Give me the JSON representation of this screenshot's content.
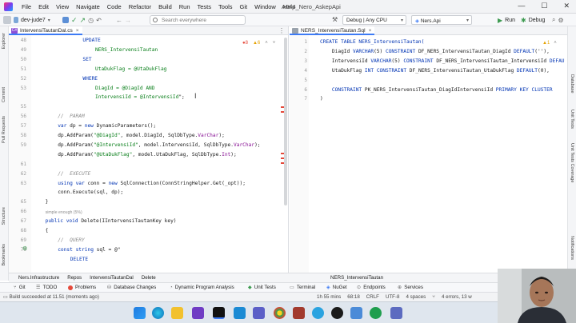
{
  "window": {
    "menu": [
      "File",
      "Edit",
      "View",
      "Navigate",
      "Code",
      "Refactor",
      "Build",
      "Run",
      "Tests",
      "Tools",
      "Git",
      "Window",
      "Help"
    ],
    "app_name": "A044_Nero_AskepApi",
    "minimize_glyph": "—",
    "maximize_glyph": "☐",
    "close_glyph": "✕"
  },
  "toolbar": {
    "branch": "dev-jude7",
    "search_placeholder": "Search everywhere",
    "config": "Debug | Any CPU",
    "project": "Ners.Api",
    "run_label": "Run",
    "debug_label": "Debug"
  },
  "left_strip": [
    "Explorer",
    "Commit",
    "Pull Requests",
    "Structure",
    "Bookmarks"
  ],
  "right_strip": [
    "Database",
    "Unit Tests",
    "Unit Tests Coverage",
    "Notifications"
  ],
  "left_editor": {
    "tab_icon": "C#",
    "tab_label": "IntervensiTautanDal.cs",
    "warnings": "8",
    "errors": "6",
    "line_numbers": [
      "48",
      "49",
      "50",
      "51",
      "52",
      "53",
      "",
      "55",
      "56",
      "57",
      "58",
      "59",
      "",
      "61",
      "62",
      "63",
      "",
      "65",
      "66",
      "67",
      "68",
      "69",
      "70"
    ],
    "lines": [
      {
        "indent": 8,
        "parts": [
          {
            "t": "UPDATE",
            "c": "kw"
          }
        ]
      },
      {
        "indent": 10,
        "parts": [
          {
            "t": "NERS_IntervensiTautan",
            "c": "str"
          }
        ]
      },
      {
        "indent": 8,
        "parts": [
          {
            "t": "SET",
            "c": "kw"
          }
        ]
      },
      {
        "indent": 10,
        "parts": [
          {
            "t": "UtaDukFlag = @UtaDukFlag",
            "c": "str"
          }
        ]
      },
      {
        "indent": 8,
        "parts": [
          {
            "t": "WHERE",
            "c": "kw"
          }
        ]
      },
      {
        "indent": 10,
        "parts": [
          {
            "t": "DiagId = @DiagId AND",
            "c": "str"
          }
        ]
      },
      {
        "indent": 10,
        "parts": [
          {
            "t": "IntervensiId = @IntervensiId",
            "c": "str"
          },
          {
            "t": "\";",
            "c": ""
          }
        ]
      },
      {
        "indent": 0,
        "parts": []
      },
      {
        "indent": 4,
        "parts": [
          {
            "t": "//  PARAM",
            "c": "cm"
          }
        ]
      },
      {
        "indent": 4,
        "parts": [
          {
            "t": "var",
            "c": "kw"
          },
          {
            "t": " dp = ",
            "c": ""
          },
          {
            "t": "new",
            "c": "kw"
          },
          {
            "t": " DynamicParameters();",
            "c": ""
          }
        ]
      },
      {
        "indent": 4,
        "parts": [
          {
            "t": "dp.AddParam(",
            "c": ""
          },
          {
            "t": "\"@DiagId\"",
            "c": "str"
          },
          {
            "t": ", model.DiagId, SqlDbType.",
            "c": ""
          },
          {
            "t": "VarChar",
            "c": "vr"
          },
          {
            "t": ");",
            "c": ""
          }
        ]
      },
      {
        "indent": 4,
        "parts": [
          {
            "t": "dp.AddParam(",
            "c": ""
          },
          {
            "t": "\"@IntervensiId\"",
            "c": "str"
          },
          {
            "t": ", model.IntervensiId, SqlDbType.",
            "c": ""
          },
          {
            "t": "VarChar",
            "c": "vr"
          },
          {
            "t": ");",
            "c": ""
          }
        ]
      },
      {
        "indent": 4,
        "parts": [
          {
            "t": "dp.AddParam(",
            "c": ""
          },
          {
            "t": "\"@UtaDukFlag\"",
            "c": "str"
          },
          {
            "t": ", model.UtaDukFlag, SqlDbType.",
            "c": ""
          },
          {
            "t": "Int",
            "c": "vr"
          },
          {
            "t": ");",
            "c": ""
          }
        ]
      },
      {
        "indent": 0,
        "parts": []
      },
      {
        "indent": 4,
        "parts": [
          {
            "t": "//  EXECUTE",
            "c": "cm"
          }
        ]
      },
      {
        "indent": 4,
        "parts": [
          {
            "t": "using",
            "c": "kw"
          },
          {
            "t": " ",
            "c": ""
          },
          {
            "t": "var",
            "c": "kw"
          },
          {
            "t": " conn = ",
            "c": ""
          },
          {
            "t": "new",
            "c": "kw"
          },
          {
            "t": " SqlConnection(ConnStringHelper.Get(_opt));",
            "c": ""
          }
        ]
      },
      {
        "indent": 4,
        "parts": [
          {
            "t": "conn.Execute(sql, dp);",
            "c": ""
          }
        ]
      },
      {
        "indent": 2,
        "parts": [
          {
            "t": "}",
            "c": ""
          }
        ]
      },
      {
        "indent": 0,
        "parts": []
      },
      {
        "indent": 2,
        "parts": [
          {
            "t": "public",
            "c": "kw"
          },
          {
            "t": " ",
            "c": ""
          },
          {
            "t": "void",
            "c": "kw"
          },
          {
            "t": " Delete(IIntervensiTautanKey key)",
            "c": ""
          }
        ]
      },
      {
        "indent": 2,
        "parts": [
          {
            "t": "{",
            "c": ""
          }
        ]
      },
      {
        "indent": 4,
        "parts": [
          {
            "t": "//  QUERY",
            "c": "cm"
          }
        ]
      },
      {
        "indent": 4,
        "parts": [
          {
            "t": "const",
            "c": "kw"
          },
          {
            "t": " ",
            "c": ""
          },
          {
            "t": "string",
            "c": "kw"
          },
          {
            "t": " sql = @\"",
            "c": ""
          }
        ]
      },
      {
        "indent": 6,
        "parts": [
          {
            "t": "DELETE",
            "c": "kw"
          }
        ]
      }
    ],
    "hint": "simple enough (5%)"
  },
  "right_editor": {
    "tab_label": "NERS_IntervensiTautan.Sql",
    "warnings": "1",
    "line_numbers": [
      "1",
      "2",
      "3",
      "4",
      "5",
      "6",
      "7"
    ],
    "lines": [
      [
        {
          "t": "CREATE TABLE NERS_IntervensiTautan(",
          "c": "kw"
        }
      ],
      [
        {
          "t": "    DiagId ",
          "c": ""
        },
        {
          "t": "VARCHAR",
          "c": "kw"
        },
        {
          "t": "(5) ",
          "c": ""
        },
        {
          "t": "CONSTRAINT",
          "c": "kw"
        },
        {
          "t": " DF_NERS_IntervensiTautan_DiagId ",
          "c": ""
        },
        {
          "t": "DEFAULT",
          "c": "kw"
        },
        {
          "t": "(''),",
          "c": ""
        }
      ],
      [
        {
          "t": "    IntervensiId ",
          "c": ""
        },
        {
          "t": "VARCHAR",
          "c": "kw"
        },
        {
          "t": "(5) ",
          "c": ""
        },
        {
          "t": "CONSTRAINT",
          "c": "kw"
        },
        {
          "t": " DF_NERS_IntervensiTautan_IntervensiId ",
          "c": ""
        },
        {
          "t": "DEFAULT",
          "c": "kw"
        }
      ],
      [
        {
          "t": "    UtaDukFlag ",
          "c": ""
        },
        {
          "t": "INT",
          "c": "kw"
        },
        {
          "t": " ",
          "c": ""
        },
        {
          "t": "CONSTRAINT",
          "c": "kw"
        },
        {
          "t": " DF_NERS_IntervensiTautan_UtaDukFlag ",
          "c": ""
        },
        {
          "t": "DEFAULT",
          "c": "kw"
        },
        {
          "t": "(0),",
          "c": ""
        }
      ],
      [],
      [
        {
          "t": "    CONSTRAINT",
          "c": "kw"
        },
        {
          "t": " PK_NERS_IntervensiTautan_DiagIdIntervensiId ",
          "c": ""
        },
        {
          "t": "PRIMARY KEY CLUSTER",
          "c": "kw"
        }
      ],
      [
        {
          "t": ")",
          "c": ""
        }
      ]
    ]
  },
  "breadcrumbs": {
    "left": [
      "Ners.Infrastructure",
      "Repos",
      "IntervensiTautanDal",
      "Delete"
    ],
    "right": [
      "NERS_IntervensiTautan"
    ]
  },
  "tool_windows": [
    "Git",
    "TODO",
    "Problems",
    "Database Changes",
    "Dynamic Program Analysis",
    "Unit Tests",
    "Terminal",
    "NuGet",
    "Endpoints",
    "Services"
  ],
  "status": {
    "message": "Build succeeded at 11.51 (moments ago)",
    "time_info": "1h 55 mins",
    "position": "68:18",
    "line_sep": "CRLF",
    "encoding": "UTF-8",
    "indent": "4 spaces",
    "errors": "4 errors, 13 w"
  },
  "colors": {
    "accent": "#3d7bf5",
    "error": "#e5493a",
    "warning": "#e5a100",
    "run_green": "#3d9a50"
  }
}
